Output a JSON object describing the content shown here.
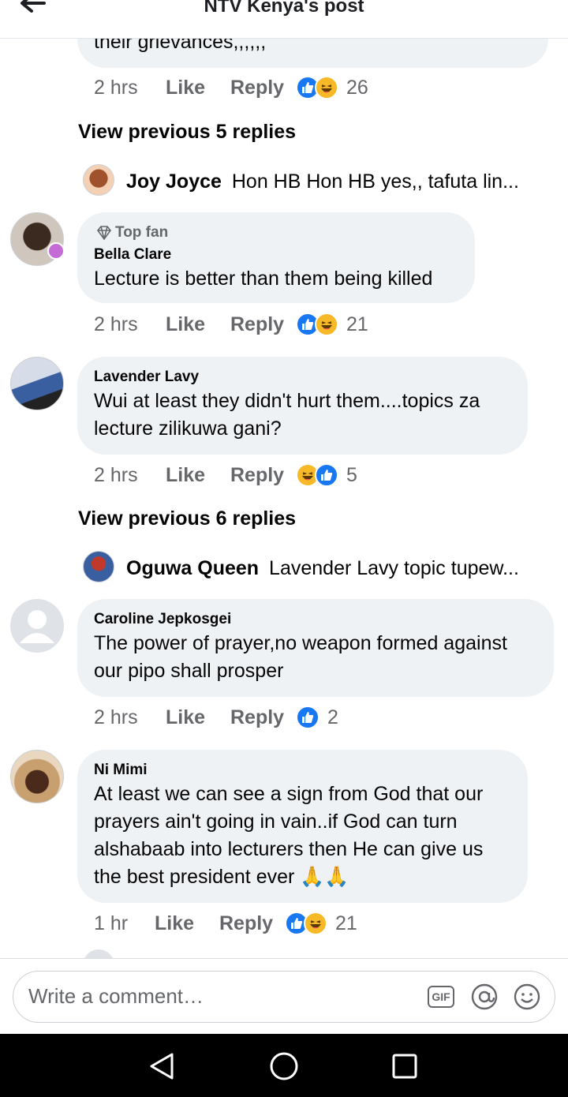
{
  "header": {
    "title": "NTV Kenya's post"
  },
  "comments": [
    {
      "truncated_text": "their grievances,,,,,,",
      "time": "2 hrs",
      "like": "Like",
      "reply": "Reply",
      "reactions": [
        "like",
        "haha"
      ],
      "count": "26"
    },
    {
      "view_previous": "View previous 5 replies",
      "reply_preview": {
        "name": "Joy Joyce",
        "text": "Hon HB Hon HB yes,, tafuta lin..."
      }
    },
    {
      "badge": "Top fan",
      "name": "Bella Clare",
      "text": "Lecture is better than them being killed",
      "time": "2 hrs",
      "like": "Like",
      "reply": "Reply",
      "reactions": [
        "like",
        "haha"
      ],
      "count": "21"
    },
    {
      "name": "Lavender Lavy",
      "text1": "Wui at least they didn't hurt them....topics za",
      "text2": "lecture zilikuwa gani?",
      "time": "2 hrs",
      "like": "Like",
      "reply": "Reply",
      "reactions": [
        "haha",
        "like"
      ],
      "count": "5",
      "view_previous": "View previous 6 replies",
      "reply_preview": {
        "name": "Oguwa Queen",
        "text": "Lavender Lavy topic tupew..."
      }
    },
    {
      "name": "Caroline Jepkosgei",
      "text1": "The power of prayer,no weapon formed against",
      "text2": "our pipo shall prosper",
      "time": "2 hrs",
      "like": "Like",
      "reply": "Reply",
      "reactions": [
        "like"
      ],
      "count": "2"
    },
    {
      "name": "Ni Mimi",
      "lines": [
        "At least we can see a sign from God that our",
        "prayers ain't going in vain..if God can turn",
        "alshabaab into lecturers then He can give us",
        "the best president ever 🙏🙏"
      ],
      "time": "1 hr",
      "like": "Like",
      "reply": "Reply",
      "reactions": [
        "like",
        "haha"
      ],
      "count": "21"
    }
  ],
  "composer": {
    "placeholder": "Write a comment…",
    "gif": "GIF"
  },
  "icons": [
    "back-arrow-icon",
    "gem-icon",
    "like-reaction-icon",
    "haha-reaction-icon",
    "gif-icon",
    "mention-icon",
    "emoji-icon",
    "nav-back-icon",
    "nav-home-icon",
    "nav-recents-icon"
  ],
  "colors": {
    "like": "#1877f2",
    "haha": "#f7b928",
    "bubble": "#eff2f5",
    "meta": "#65676b"
  }
}
